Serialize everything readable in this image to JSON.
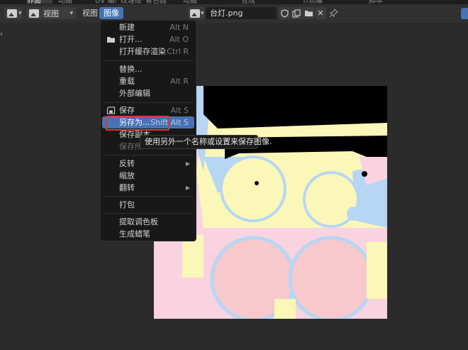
{
  "top_tabs": [
    "界面",
    "动画",
    "UV 编辑",
    "纹理绘制",
    "着色器",
    "动画",
    "合成",
    "节点编辑器",
    "脚本"
  ],
  "header": {
    "view_label_1": "视图",
    "view_label_2": "视图",
    "image_menu": "图像",
    "filename": "台灯.png"
  },
  "menu": {
    "new": {
      "label": "新建",
      "shortcut": "Alt N"
    },
    "open": {
      "label": "打开...",
      "shortcut": "Alt O"
    },
    "open_cache": {
      "label": "打开缓存渲染",
      "shortcut": "Ctrl R"
    },
    "replace": {
      "label": "替换..."
    },
    "reload": {
      "label": "重载",
      "shortcut": "Alt R"
    },
    "external_edit": {
      "label": "外部编辑"
    },
    "save": {
      "label": "保存",
      "shortcut": "Alt S"
    },
    "save_as": {
      "label": "另存为...",
      "shortcut": "Shift Alt S"
    },
    "save_copy": {
      "label": "保存副本"
    },
    "save_all": {
      "label": "保存所"
    },
    "invert": {
      "label": "反转"
    },
    "resize": {
      "label": "缩放"
    },
    "flip": {
      "label": "翻转"
    },
    "pack": {
      "label": "打包"
    },
    "extract_palette": {
      "label": "提取调色板"
    },
    "generate_gpencil": {
      "label": "生成蜡笔"
    }
  },
  "tooltip": "使用另外一个名称或设置来保存图像.",
  "colors": {
    "accent": "#4772b3",
    "highlight_box": "#e0353a",
    "uv_yellow": "#fbf7b8",
    "uv_pink": "#f9d3df",
    "uv_blue": "#b7d6f4"
  }
}
